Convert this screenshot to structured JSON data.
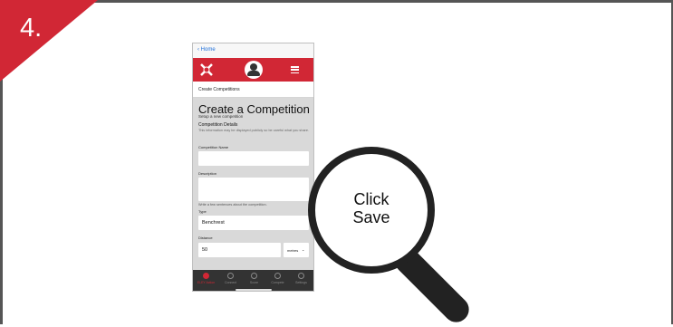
{
  "step": {
    "number": "4."
  },
  "phone": {
    "back_label": "Home",
    "breadcrumb": "Create Competitions",
    "form": {
      "title": "Create a Competition",
      "subtitle": "Setup a new competition",
      "section_title": "Competition Details",
      "section_note": "This information may be displayed publicly so be careful what you share.",
      "name_label": "Competition Name",
      "name_value": "",
      "description_label": "Description",
      "description_value": "",
      "description_hint": "Write a few sentences about the competition.",
      "type_label": "Type",
      "type_value": "Benchrest",
      "distance_label": "Distance",
      "distance_value": "50",
      "distance_unit": "metres"
    },
    "tabbar": {
      "tabs": [
        {
          "label": "ELEY Action",
          "icon": "target-icon",
          "active": true
        },
        {
          "label": "Connect",
          "icon": "wifi-icon",
          "active": false
        },
        {
          "label": "Score",
          "icon": "crosshair-icon",
          "active": false
        },
        {
          "label": "Compete",
          "icon": "trophy-icon",
          "active": false
        },
        {
          "label": "Settings",
          "icon": "gear-icon",
          "active": false
        }
      ]
    }
  },
  "magnifier": {
    "line1": "Click",
    "line2": "Save"
  },
  "colors": {
    "accent": "#d12735",
    "dark": "#222222",
    "form_bg": "#d9d9d9",
    "tabbar_bg": "#333333"
  }
}
